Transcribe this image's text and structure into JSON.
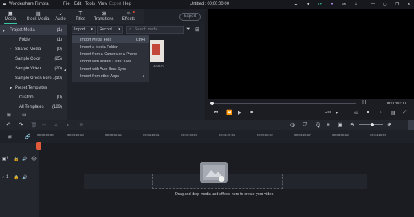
{
  "app": {
    "name": "Wondershare Filmora",
    "menus": [
      "File",
      "Edit",
      "Tools",
      "View",
      "Export",
      "Help"
    ],
    "doc_title": "Untitled : 00:00:00:00"
  },
  "tabs": [
    {
      "label": "Media",
      "icon": "media-icon"
    },
    {
      "label": "Stock Media",
      "icon": "stock-media-icon"
    },
    {
      "label": "Audio",
      "icon": "audio-icon"
    },
    {
      "label": "Titles",
      "icon": "titles-icon"
    },
    {
      "label": "Transitions",
      "icon": "transitions-icon"
    },
    {
      "label": "Effects",
      "icon": "effects-icon"
    }
  ],
  "export_label": "Export",
  "sidebar": {
    "items": [
      {
        "label": "Project Media",
        "count": "(1)"
      },
      {
        "label": "Folder",
        "count": "(1)"
      },
      {
        "label": "Shared Media",
        "count": "(0)"
      },
      {
        "label": "Sample Color",
        "count": "(25)"
      },
      {
        "label": "Sample Video",
        "count": "(20)"
      },
      {
        "label": "Sample Green Scre...",
        "count": "(10)"
      },
      {
        "label": "Preset Templates",
        "count": ""
      },
      {
        "label": "Custom",
        "count": "(0)"
      },
      {
        "label": "All Templates",
        "count": "(189)"
      }
    ]
  },
  "media": {
    "import_label": "Import",
    "record_label": "Record",
    "search_placeholder": "Search media",
    "thumb_caption": "...9-0a-s9..."
  },
  "import_menu": [
    {
      "label": "Import Media Files",
      "shortcut": "Ctrl+I"
    },
    {
      "label": "Import a Media Folder",
      "shortcut": ""
    },
    {
      "label": "Import from a Camera or a Phone",
      "shortcut": ""
    },
    {
      "label": "Import with Instant Cutter Tool",
      "shortcut": ""
    },
    {
      "label": "Import with Auto Beat Sync",
      "shortcut": ""
    },
    {
      "label": "Import from other Apps",
      "shortcut": "▸"
    }
  ],
  "preview": {
    "timecode": "00:00:00:00",
    "quality": "Full",
    "brackets": "{   }"
  },
  "timeline": {
    "ruler": [
      "00:00:00:00",
      "00:00:29:18",
      "00:00:59:15",
      "00:01:29:11",
      "00:01:59:06",
      "00:02:29:02",
      "00:02:58:22",
      "00:03:28:17",
      "00:03:58:13",
      "00:04:28:09"
    ],
    "tracks": [
      {
        "label": "1"
      },
      {
        "label": "1"
      }
    ],
    "drop_text": "Drag and drop media and effects here to create your video."
  }
}
